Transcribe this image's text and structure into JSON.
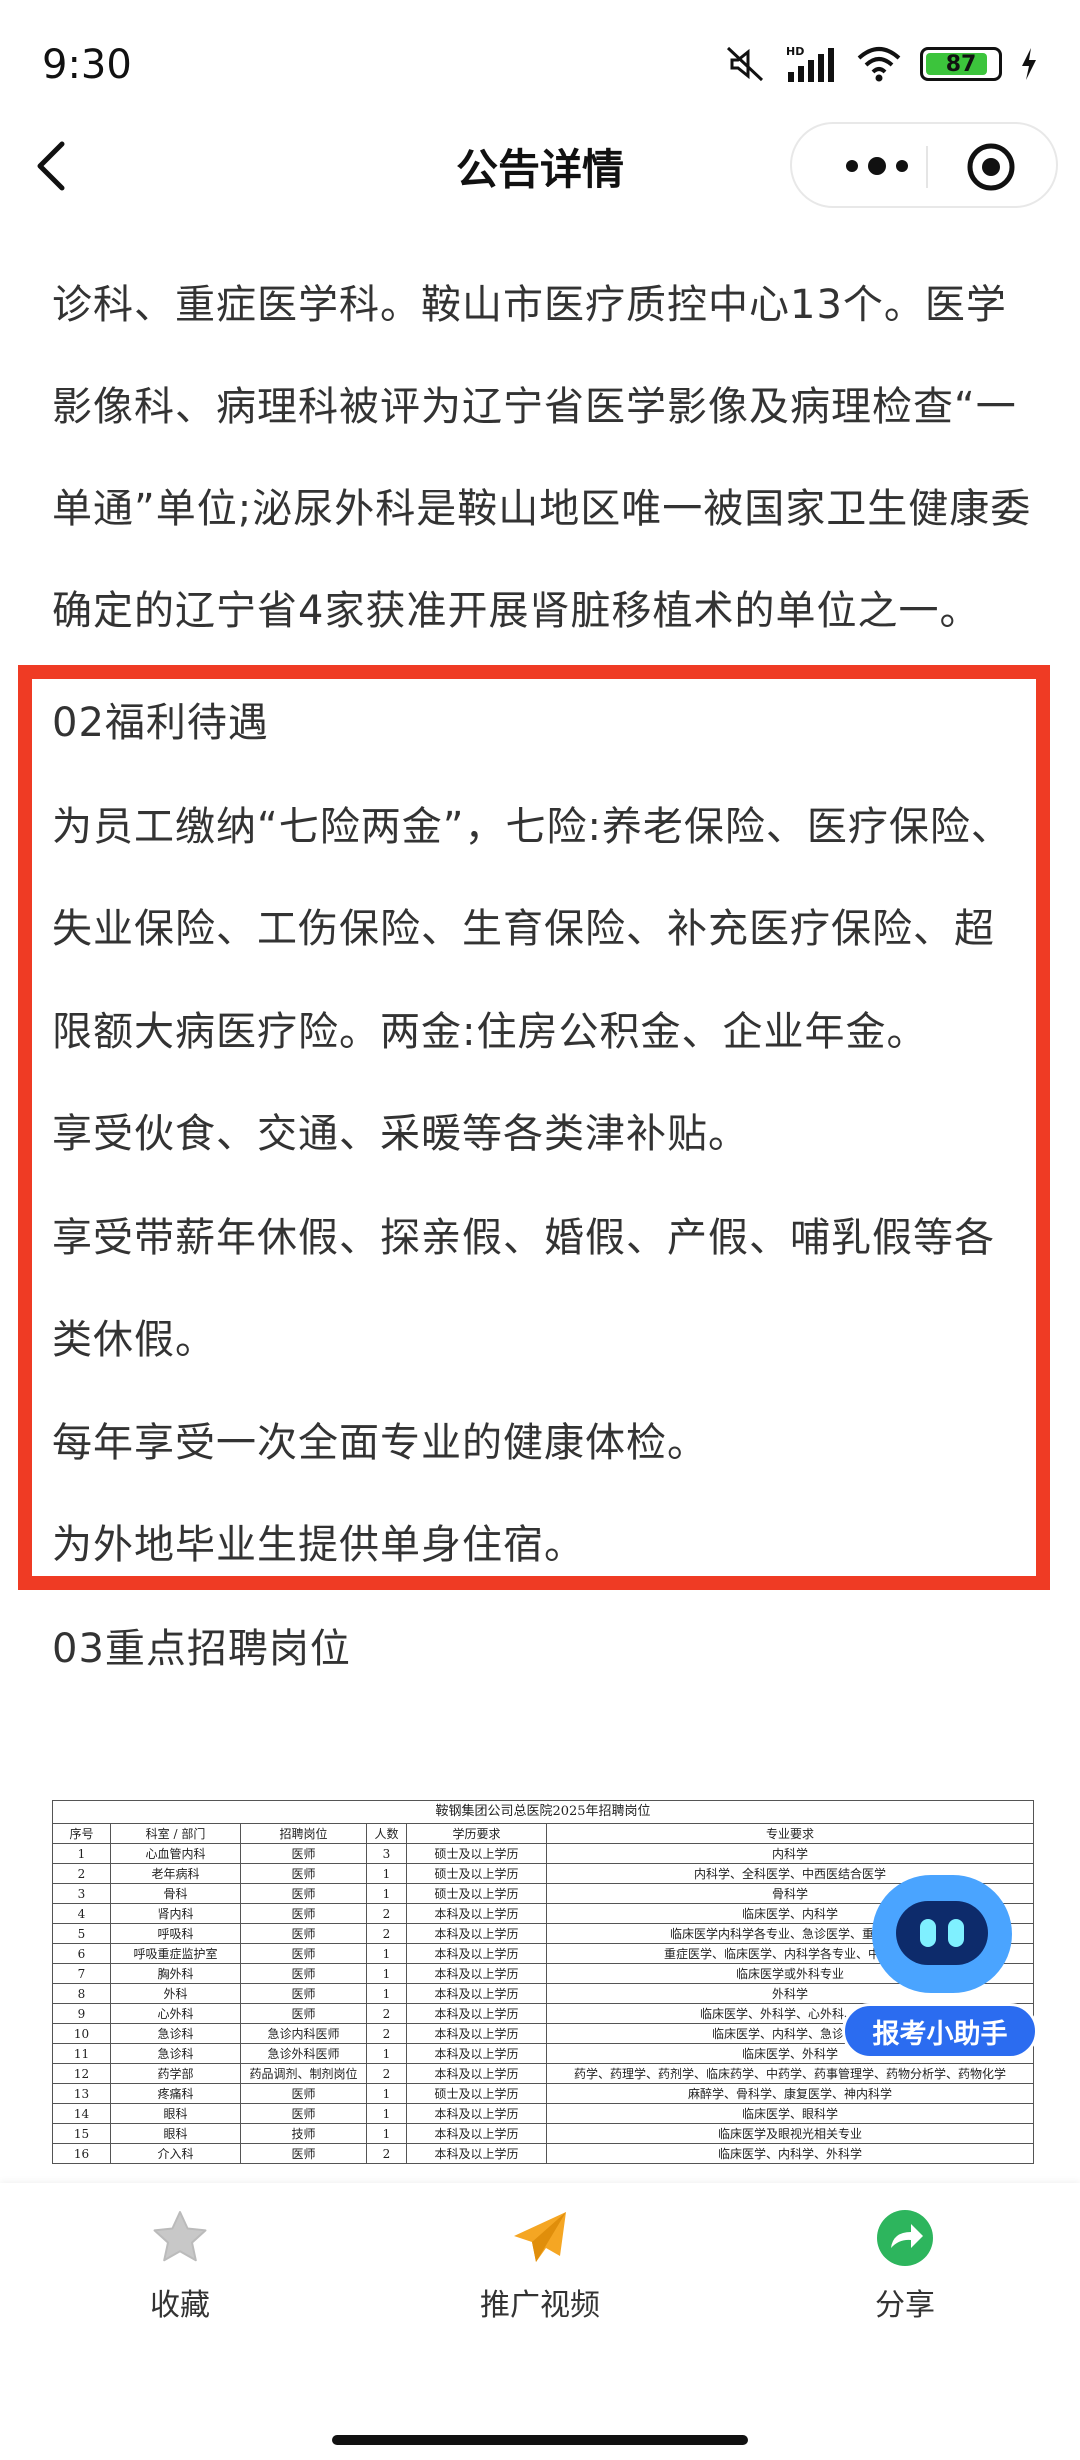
{
  "status_bar": {
    "time": "9:30",
    "battery": "87"
  },
  "nav": {
    "title": "公告详情"
  },
  "article": {
    "intro_lines": [
      "诊科、重症医学科。鞍山市医疗质控中心13个。医学",
      "影像科、病理科被评为辽宁省医学影像及病理检查“一",
      "单通”单位;泌尿外科是鞍山地区唯一被国家卫生健康委",
      "确定的辽宁省4家获准开展肾脏移植术的单位之一。"
    ],
    "benefits_heading": "02福利待遇",
    "benefits_lines": [
      "为员工缴纳“七险两金”，七险:养老保险、医疗保险、",
      "失业保险、工伤保险、生育保险、补充医疗保险、超",
      "限额大病医疗险。两金:住房公积金、企业年金。",
      "享受伙食、交通、采暖等各类津补贴。",
      "享受带薪年休假、探亲假、婚假、产假、哺乳假等各",
      "类休假。",
      "每年享受一次全面专业的健康体检。",
      "为外地毕业生提供单身住宿。"
    ],
    "positions_heading": "03重点招聘岗位"
  },
  "table": {
    "caption": "鞍钢集团公司总医院2025年招聘岗位",
    "headers": [
      "序号",
      "科室 / 部门",
      "招聘岗位",
      "人数",
      "学历要求",
      "专业要求"
    ],
    "rows": [
      [
        "1",
        "心血管内科",
        "医师",
        "3",
        "硕士及以上学历",
        "内科学"
      ],
      [
        "2",
        "老年病科",
        "医师",
        "1",
        "硕士及以上学历",
        "内科学、全科医学、中西医结合医学"
      ],
      [
        "3",
        "骨科",
        "医师",
        "1",
        "硕士及以上学历",
        "骨科学"
      ],
      [
        "4",
        "肾内科",
        "医师",
        "2",
        "本科及以上学历",
        "临床医学、内科学"
      ],
      [
        "5",
        "呼吸科",
        "医师",
        "2",
        "本科及以上学历",
        "临床医学内科学各专业、急诊医学、重症医学"
      ],
      [
        "6",
        "呼吸重症监护室",
        "医师",
        "1",
        "本科及以上学历",
        "重症医学、临床医学、内科学各专业、中西医结"
      ],
      [
        "7",
        "胸外科",
        "医师",
        "1",
        "本科及以上学历",
        "临床医学或外科专业"
      ],
      [
        "8",
        "外科",
        "医师",
        "1",
        "本科及以上学历",
        "外科学"
      ],
      [
        "9",
        "心外科",
        "医师",
        "2",
        "本科及以上学历",
        "临床医学、外科学、心外科、胸外"
      ],
      [
        "10",
        "急诊科",
        "急诊内科医师",
        "2",
        "本科及以上学历",
        "临床医学、内科学、急诊医学"
      ],
      [
        "11",
        "急诊科",
        "急诊外科医师",
        "1",
        "本科及以上学历",
        "临床医学、外科学"
      ],
      [
        "12",
        "药学部",
        "药品调剂、制剂岗位",
        "2",
        "本科及以上学历",
        "药学、药理学、药剂学、临床药学、中药学、药事管理学、药物分析学、药物化学"
      ],
      [
        "13",
        "疼痛科",
        "医师",
        "1",
        "硕士及以上学历",
        "麻醉学、骨科学、康复医学、神内科学"
      ],
      [
        "14",
        "眼科",
        "医师",
        "1",
        "本科及以上学历",
        "临床医学、眼科学"
      ],
      [
        "15",
        "眼科",
        "技师",
        "1",
        "本科及以上学历",
        "临床医学及眼视光相关专业"
      ],
      [
        "16",
        "介入科",
        "医师",
        "2",
        "本科及以上学历",
        "临床医学、内科学、外科学"
      ]
    ]
  },
  "assistant": {
    "label": "报考小助手"
  },
  "bottom_bar": {
    "tabs": [
      {
        "label": "收藏",
        "icon": "star-icon",
        "color": "#c8c8c8"
      },
      {
        "label": "推广视频",
        "icon": "paper-plane-icon",
        "color": "#f5a623"
      },
      {
        "label": "分享",
        "icon": "share-arrow-icon",
        "color": "#2db55d"
      }
    ]
  },
  "colors": {
    "highlight": "#ef3b24",
    "assistant": "#2b6cf0"
  }
}
